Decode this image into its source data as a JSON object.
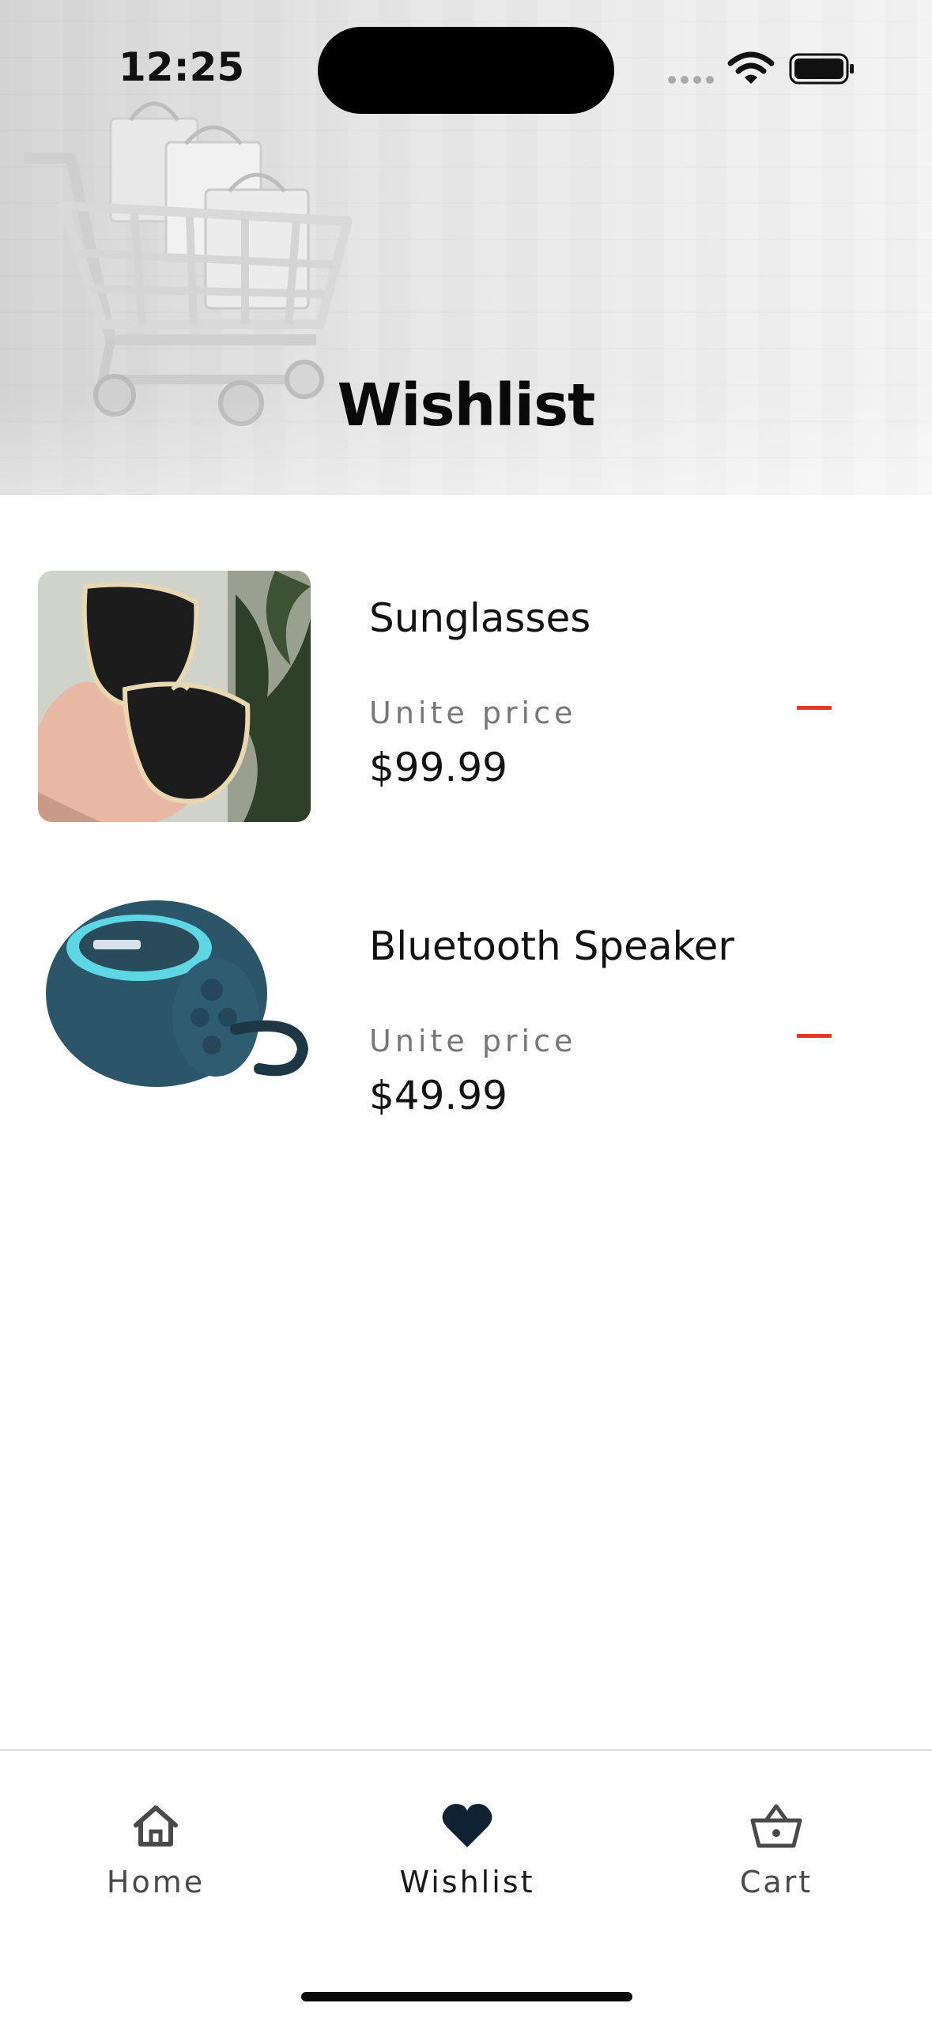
{
  "status_bar": {
    "time": "12:25"
  },
  "header": {
    "title": "Wishlist"
  },
  "wishlist": {
    "items": [
      {
        "name": "Sunglasses",
        "unit_label": "Unite price",
        "price": "$99.99"
      },
      {
        "name": "Bluetooth Speaker",
        "unit_label": "Unite price",
        "price": "$49.99"
      }
    ]
  },
  "bottom_nav": {
    "items": [
      {
        "label": "Home",
        "icon": "home-icon",
        "active": false
      },
      {
        "label": "Wishlist",
        "icon": "heart-icon",
        "active": true
      },
      {
        "label": "Cart",
        "icon": "basket-icon",
        "active": false
      }
    ]
  },
  "colors": {
    "accent_remove": "#e0392b",
    "nav_active": "#0e2233",
    "text_primary": "#121212",
    "text_muted": "#777777"
  }
}
